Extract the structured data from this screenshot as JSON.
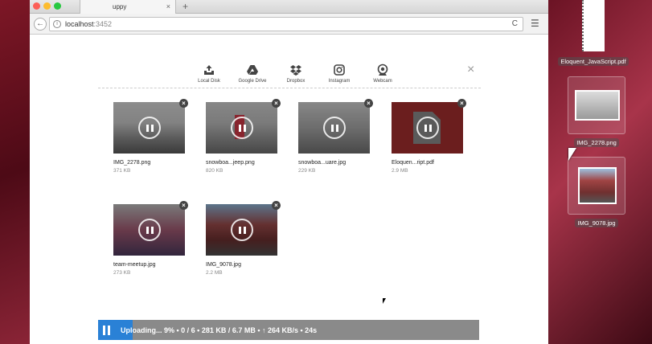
{
  "browser": {
    "tab_title": "uppy",
    "tab_close": "×",
    "new_tab": "+",
    "url_host": "localhost",
    "url_port": ":3452",
    "back_icon": "←",
    "reload_icon": "C",
    "menu_icon": "☰",
    "info_icon": "i"
  },
  "providers": [
    {
      "label": "Local Disk",
      "icon": "local-disk-icon"
    },
    {
      "label": "Google Drive",
      "icon": "google-drive-icon"
    },
    {
      "label": "Dropbox",
      "icon": "dropbox-icon"
    },
    {
      "label": "Instagram",
      "icon": "instagram-icon"
    },
    {
      "label": "Webcam",
      "icon": "webcam-icon"
    }
  ],
  "close_icon": "×",
  "files": [
    {
      "name": "IMG_2278.png",
      "size": "371 KB"
    },
    {
      "name": "snowboa...jeep.png",
      "size": "820 KB"
    },
    {
      "name": "snowboa...uare.jpg",
      "size": "229 KB"
    },
    {
      "name": "Eloquen...ript.pdf",
      "size": "2.9 MB"
    },
    {
      "name": "team-meetup.jpg",
      "size": "273 KB"
    },
    {
      "name": "IMG_9078.jpg",
      "size": "2.2 MB"
    }
  ],
  "remove_icon": "×",
  "status": {
    "text": "Uploading... 9% • 0 / 6 • 281 KB / 6.7 MB • ↑ 264 KB/s • 24s",
    "progress_percent": 9
  },
  "desktop": {
    "items": [
      {
        "label": "Eloquent_JavaScript.pdf"
      },
      {
        "label": "IMG_2278.png"
      },
      {
        "label": "IMG_9078.jpg"
      }
    ]
  }
}
